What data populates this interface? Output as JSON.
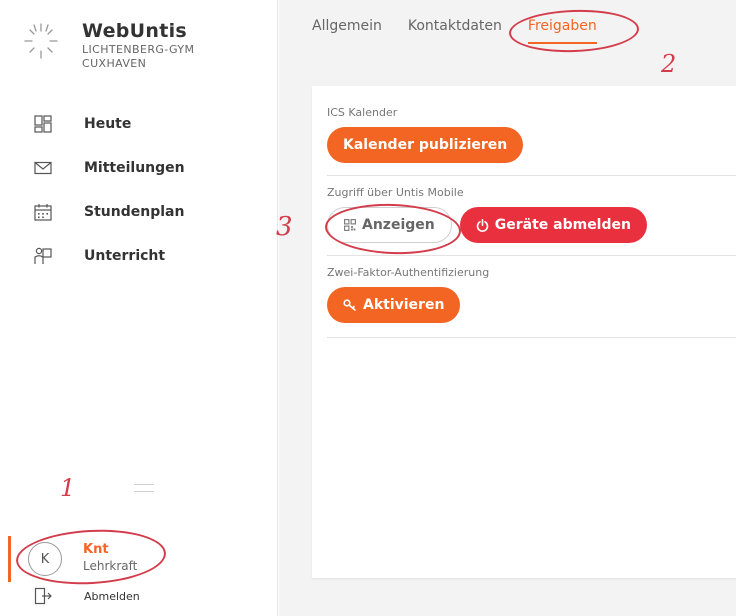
{
  "brand": {
    "title": "WebUntis",
    "school_line1": "LICHTENBERG-GYM",
    "school_line2": "CUXHAVEN"
  },
  "sidebar": {
    "items": [
      {
        "label": "Heute",
        "icon": "dashboard-icon"
      },
      {
        "label": "Mitteilungen",
        "icon": "mail-icon"
      },
      {
        "label": "Stundenplan",
        "icon": "calendar-icon"
      },
      {
        "label": "Unterricht",
        "icon": "teacher-icon"
      }
    ],
    "user": {
      "initial": "K",
      "name": "Knt",
      "role": "Lehrkraft"
    },
    "logout_label": "Abmelden"
  },
  "tabs": [
    {
      "label": "Allgemein",
      "active": false
    },
    {
      "label": "Kontaktdaten",
      "active": false
    },
    {
      "label": "Freigaben",
      "active": true
    }
  ],
  "sections": {
    "ics": {
      "label": "ICS Kalender",
      "button": "Kalender publizieren"
    },
    "mobile": {
      "label": "Zugriff über Untis Mobile",
      "show_button": "Anzeigen",
      "logout_devices_button": "Geräte abmelden"
    },
    "twofa": {
      "label": "Zwei-Faktor-Authentifizierung",
      "button": "Aktivieren"
    }
  },
  "annotations": {
    "one": "1",
    "two": "2",
    "three": "3"
  },
  "colors": {
    "accent": "#f26522",
    "danger": "#e8303f",
    "annotation": "#d33c4a"
  }
}
